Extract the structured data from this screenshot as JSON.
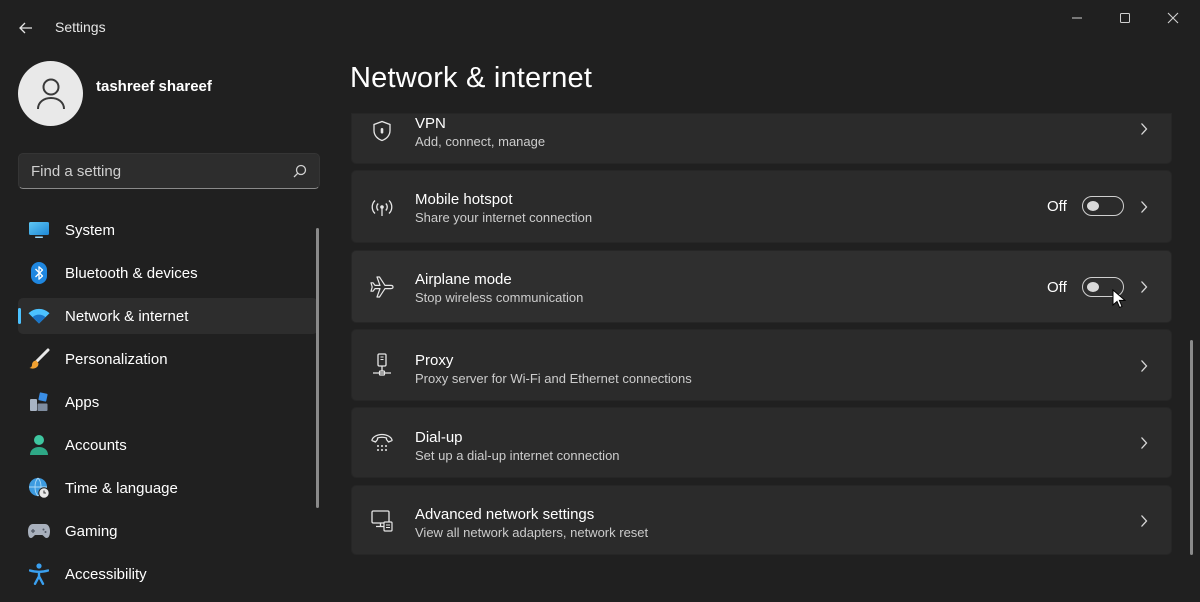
{
  "window": {
    "title": "Settings",
    "controls": {
      "minimize": "minimize-icon",
      "maximize": "maximize-icon",
      "close": "close-icon"
    }
  },
  "user": {
    "name": "tashreef shareef",
    "avatar_icon": "person-icon"
  },
  "search": {
    "placeholder": "Find a setting",
    "value": "",
    "icon": "search-icon"
  },
  "sidebar": {
    "accent": "#4cc2ff",
    "items": [
      {
        "label": "System",
        "icon": "monitor-icon",
        "active": false
      },
      {
        "label": "Bluetooth & devices",
        "icon": "bluetooth-icon",
        "active": false
      },
      {
        "label": "Network & internet",
        "icon": "wifi-icon",
        "active": true
      },
      {
        "label": "Personalization",
        "icon": "brush-icon",
        "active": false
      },
      {
        "label": "Apps",
        "icon": "apps-icon",
        "active": false
      },
      {
        "label": "Accounts",
        "icon": "account-icon",
        "active": false
      },
      {
        "label": "Time & language",
        "icon": "globe-clock-icon",
        "active": false
      },
      {
        "label": "Gaming",
        "icon": "gamepad-icon",
        "active": false
      },
      {
        "label": "Accessibility",
        "icon": "accessibility-icon",
        "active": false
      }
    ]
  },
  "main": {
    "title": "Network & internet",
    "cards": [
      {
        "title": "VPN",
        "subtitle": "Add, connect, manage",
        "icon": "shield-icon"
      },
      {
        "title": "Mobile hotspot",
        "subtitle": "Share your internet connection",
        "icon": "hotspot-icon",
        "toggle": {
          "state": "Off",
          "on": false
        }
      },
      {
        "title": "Airplane mode",
        "subtitle": "Stop wireless communication",
        "icon": "airplane-icon",
        "toggle": {
          "state": "Off",
          "on": false
        }
      },
      {
        "title": "Proxy",
        "subtitle": "Proxy server for Wi-Fi and Ethernet connections",
        "icon": "proxy-icon"
      },
      {
        "title": "Dial-up",
        "subtitle": "Set up a dial-up internet connection",
        "icon": "dialup-icon"
      },
      {
        "title": "Advanced network settings",
        "subtitle": "View all network adapters, network reset",
        "icon": "advanced-network-icon"
      }
    ]
  }
}
